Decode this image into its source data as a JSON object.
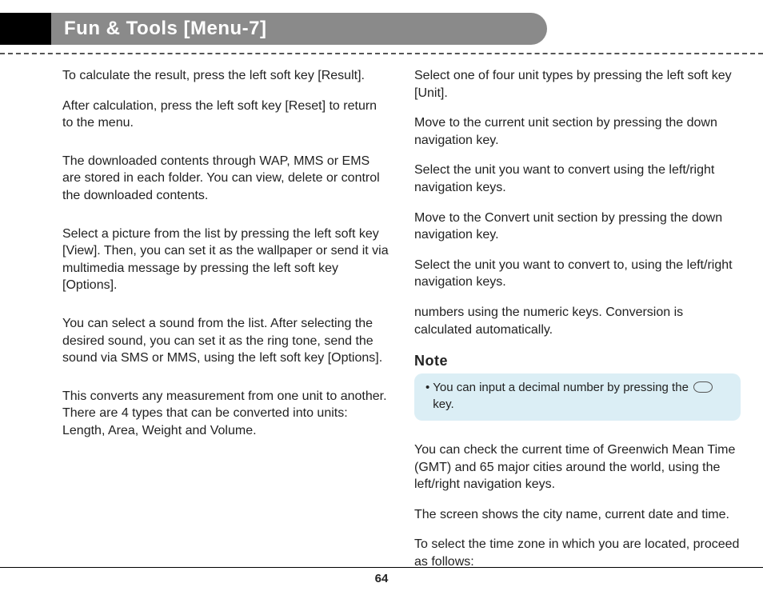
{
  "header": {
    "title": "Fun & Tools [Menu-7]"
  },
  "left": {
    "p1": "To calculate the result, press the left soft key [Result].",
    "p2": "After calculation, press the left soft key [Reset] to return to the menu.",
    "p3": "The downloaded contents through WAP, MMS or EMS are stored in each folder. You can view, delete or control the downloaded contents.",
    "p4": "Select a picture from the list by pressing the left soft key [View]. Then, you can set it as the wallpaper or send it via multimedia message by pressing the left soft key [Options].",
    "p5": "You can select a sound from the list. After selecting the desired sound, you can set it as the ring tone, send the sound via SMS or MMS, using the left soft key [Options].",
    "p6": "This converts any measurement from one unit to another. There are 4 types that can be converted into units: Length, Area, Weight and Volume."
  },
  "right": {
    "p1": "Select one of four unit types by pressing the left soft key [Unit].",
    "p2": "Move to the current unit section by pressing the down navigation key.",
    "p3": "Select the unit you want to convert using the left/right navigation keys.",
    "p4": "Move to the Convert unit section by pressing the down navigation key.",
    "p5": "Select the unit you want to convert to, using the left/right navigation keys.",
    "p6": "numbers using the numeric keys. Conversion is calculated automatically.",
    "note_title": "Note",
    "note_pre": "You can input a decimal number by pressing the",
    "note_post": " key.",
    "p7": "You can check the current time of Greenwich Mean Time (GMT) and 65 major cities around the world, using the left/right navigation keys.",
    "p8": "The screen shows the city name, current date and time.",
    "p9": "To select the time zone in which you are located, proceed as follows:"
  },
  "page_number": "64"
}
